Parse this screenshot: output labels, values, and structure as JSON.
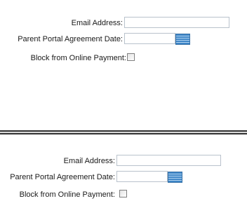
{
  "panels": [
    {
      "email_label": "Email Address:",
      "email_value": "",
      "agreement_label": "Parent Portal Agreement Date:",
      "agreement_value": "",
      "calendar_icon": "calendar-icon",
      "block_label": "Block from Online Payment:",
      "block_checked": false
    },
    {
      "email_label": "Email Address:",
      "email_value": "",
      "agreement_label": "Parent Portal Agreement Date:",
      "agreement_value": "",
      "calendar_icon": "calendar-icon",
      "block_label": "Block from Online Payment:",
      "block_checked": false
    }
  ]
}
